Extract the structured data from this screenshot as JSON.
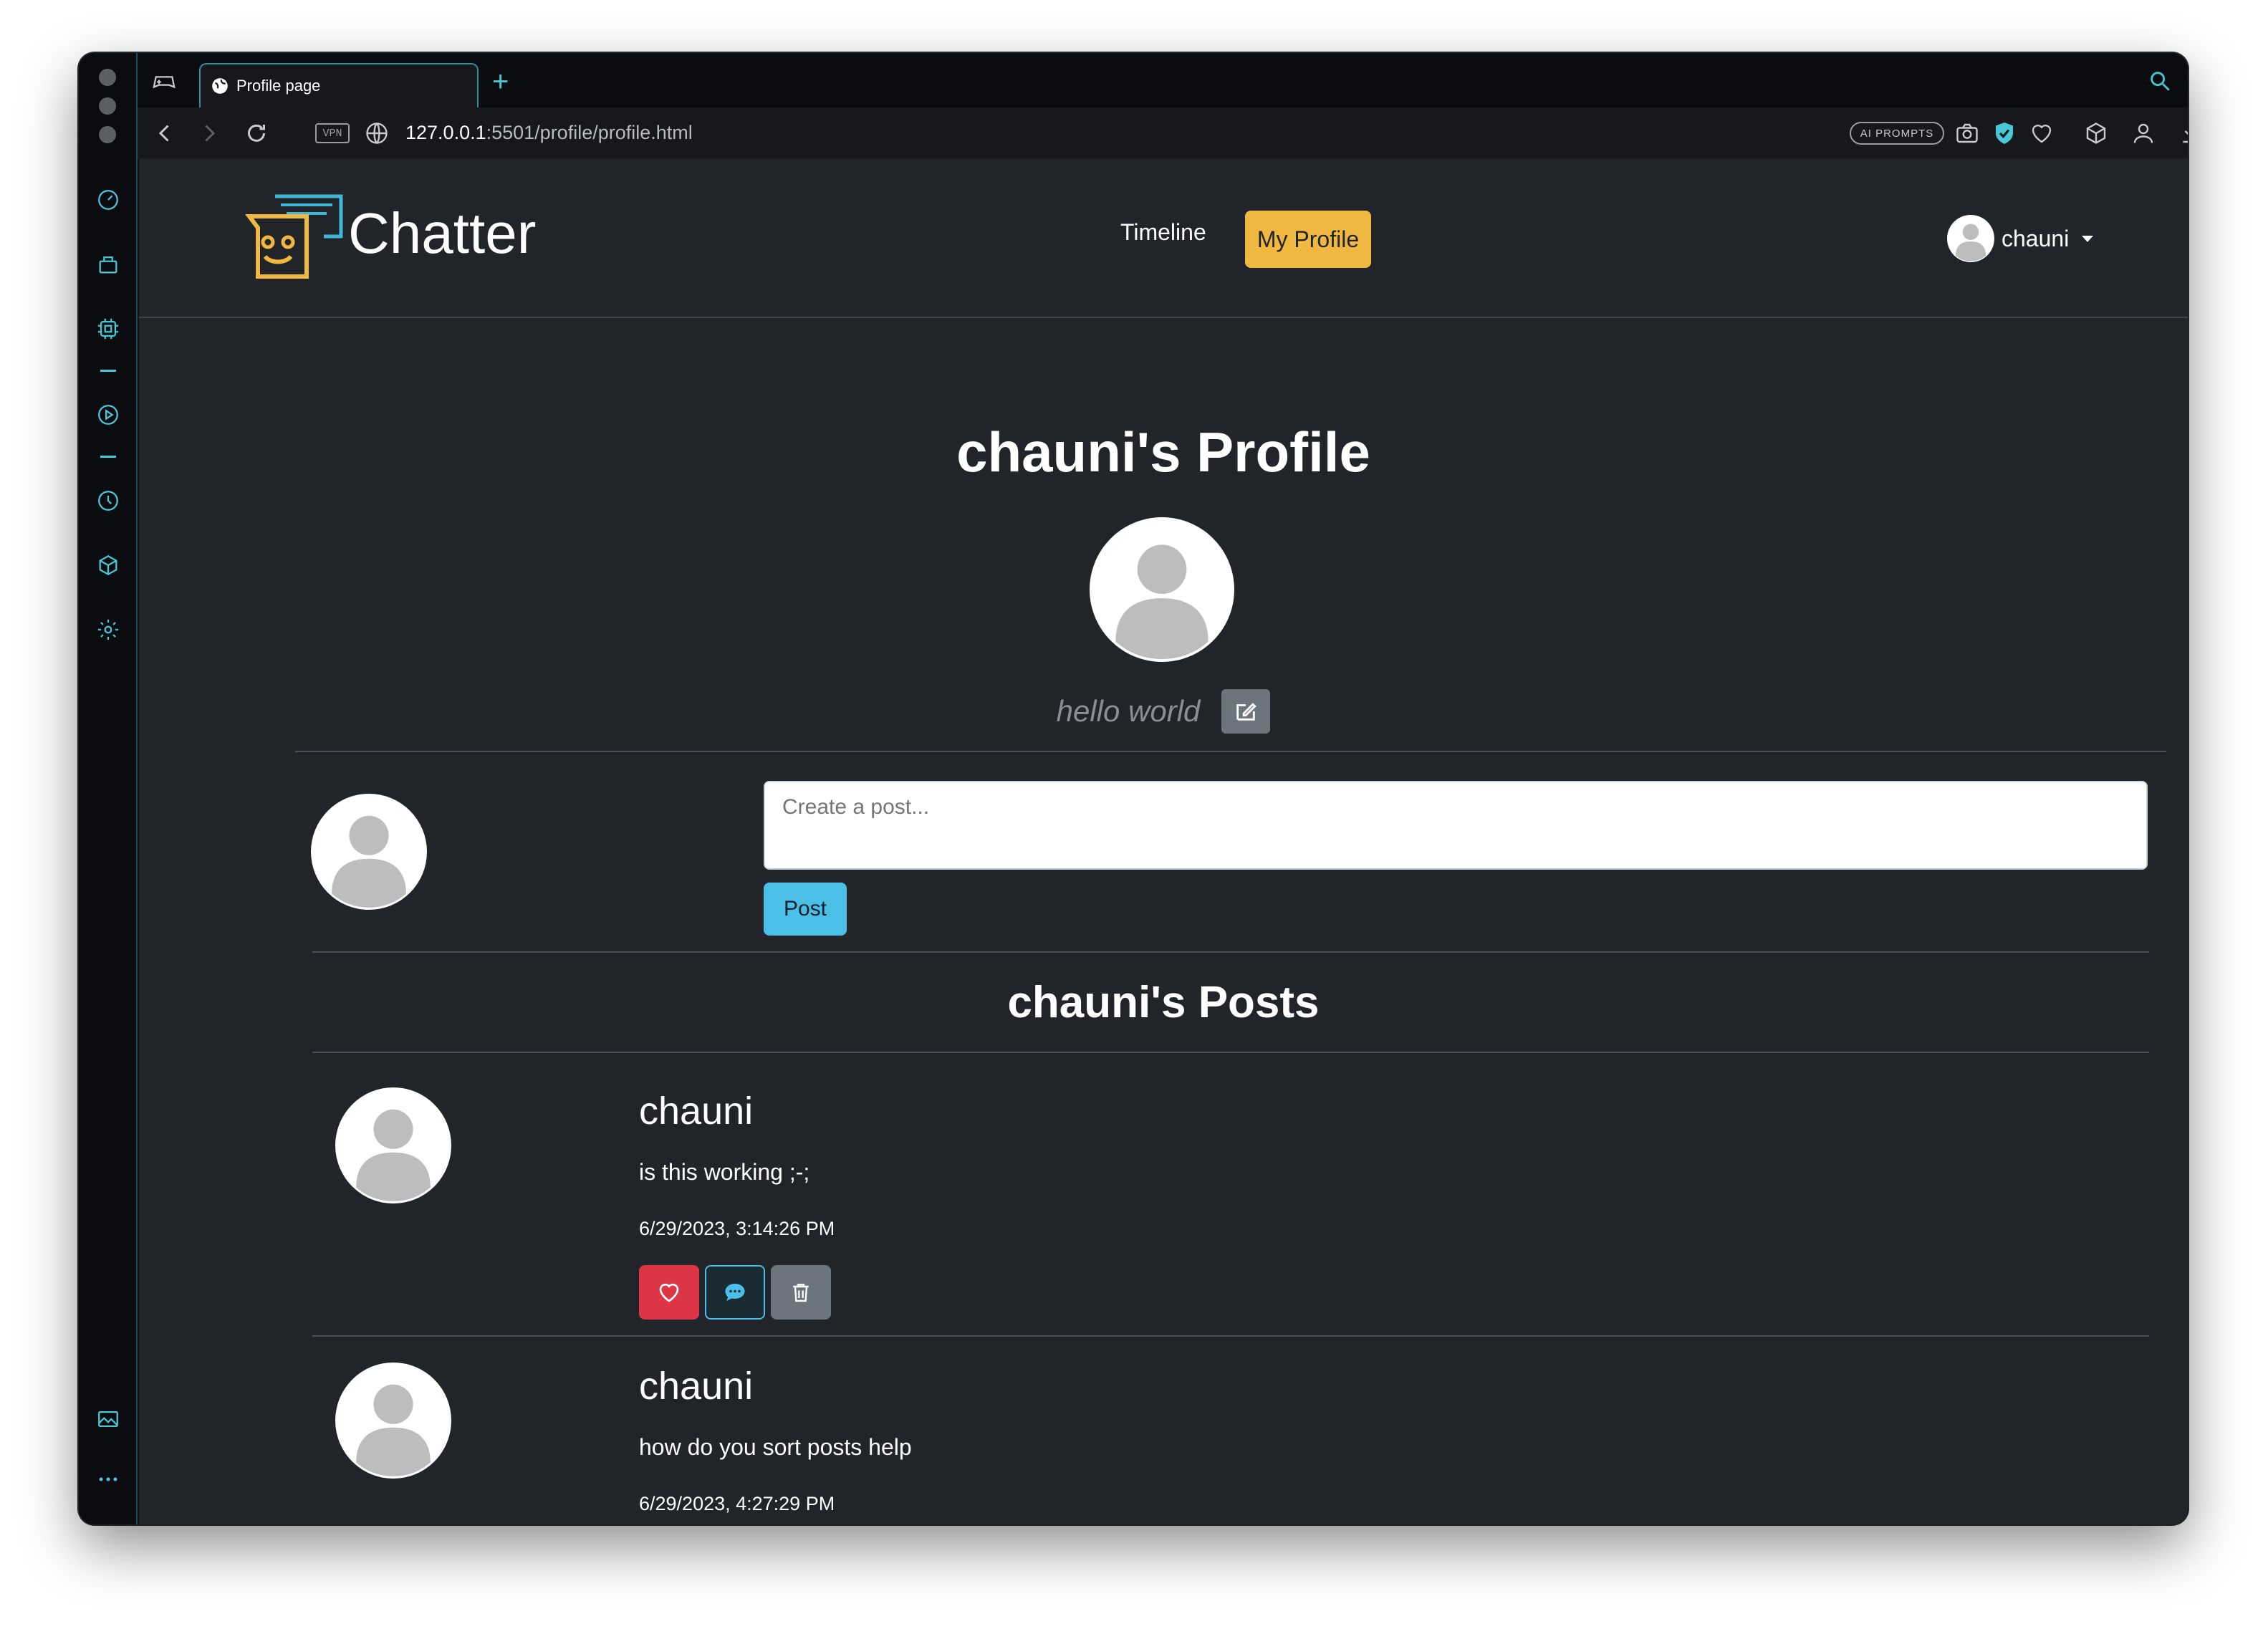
{
  "browser": {
    "tab_title": "Profile page",
    "url_host": "127.0.0.1",
    "url_rest": ":5501/profile/profile.html",
    "vpn_label": "VPN",
    "ai_prompts_label": "AI PROMPTS"
  },
  "navbar": {
    "brand": "Chatter",
    "links": [
      {
        "label": "Timeline",
        "active": false
      },
      {
        "label": "My Profile",
        "active": true
      }
    ],
    "user": "chauni"
  },
  "profile": {
    "title": "chauni's Profile",
    "bio": "hello world"
  },
  "composer": {
    "placeholder": "Create a post...",
    "button_label": "Post"
  },
  "posts_title": "chauni's Posts",
  "posts": [
    {
      "author": "chauni",
      "body": "is this working ;-;",
      "timestamp": "6/29/2023, 3:14:26 PM"
    },
    {
      "author": "chauni",
      "body": "how do you sort posts help",
      "timestamp": "6/29/2023, 4:27:29 PM"
    }
  ],
  "colors": {
    "accent_yellow": "#f0b840",
    "accent_cyan": "#4bbfe8",
    "danger": "#dc3545",
    "secondary": "#6c757d",
    "page_bg": "#212529"
  }
}
